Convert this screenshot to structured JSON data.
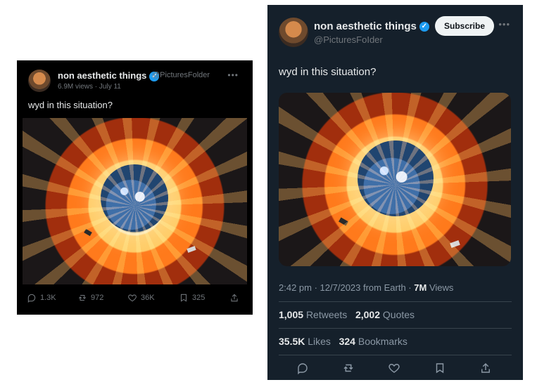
{
  "left_card": {
    "name": "non aesthetic things",
    "handle": "@PicturesFolder",
    "views": "6.9M views",
    "date": "July 11",
    "text": "wyd in this situation?",
    "actions": {
      "replies": "1.3K",
      "retweets": "972",
      "likes": "36K",
      "bookmarks": "325"
    }
  },
  "right_card": {
    "name": "non aesthetic things",
    "handle": "@PicturesFoIder",
    "subscribe_label": "Subscribe",
    "text": "wyd in this situation?",
    "time": "2:42 pm",
    "date": "12/7/2023 from Earth",
    "views_count": "7M",
    "views_label": "Views",
    "retweets_count": "1,005",
    "retweets_label": "Retweets",
    "quotes_count": "2,002",
    "quotes_label": "Quotes",
    "likes_count": "35.5K",
    "likes_label": "Likes",
    "bookmarks_count": "324",
    "bookmarks_label": "Bookmarks"
  },
  "icons": {
    "verified": "verified-badge-icon",
    "reply": "reply-icon",
    "retweet": "retweet-icon",
    "like": "heart-icon",
    "bookmark": "bookmark-icon",
    "share": "share-icon",
    "more": "more-icon"
  },
  "colors": {
    "left_background": "#000000",
    "right_background": "#15202b",
    "verified": "#1d9bf0",
    "text_primary": "#e7e9ea",
    "text_secondary": "#71767b",
    "divider": "#38444d"
  }
}
